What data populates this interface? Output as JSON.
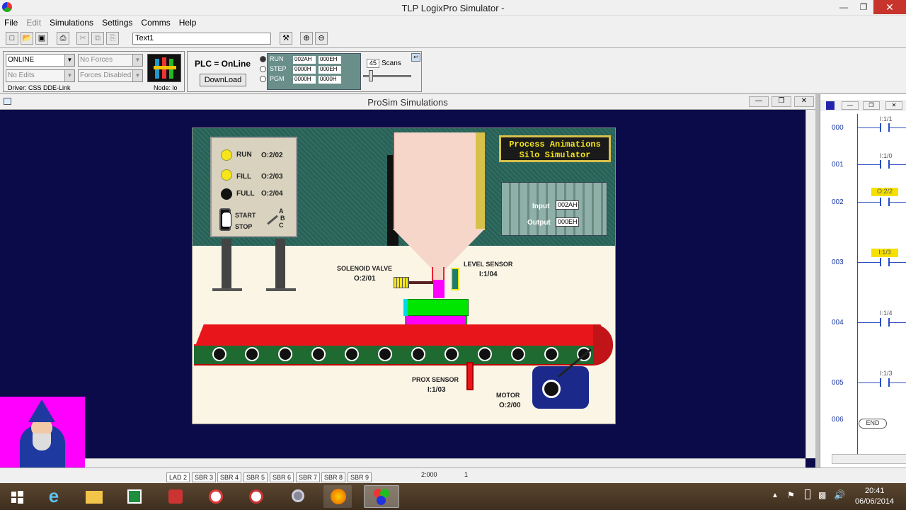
{
  "app": {
    "title": "TLP LogixPro Simulator  -"
  },
  "menu": [
    "File",
    "Edit",
    "Simulations",
    "Settings",
    "Comms",
    "Help"
  ],
  "toolbar": {
    "text_field": "Text1"
  },
  "status": {
    "mode": "ONLINE",
    "forces": "No Forces",
    "edits": "No Edits",
    "forces_disabled": "Forces Disabled",
    "driver": "Driver: CSS DDE-Link",
    "node": "Node: lo",
    "plc_state": "PLC = OnLine",
    "download_label": "DownLoad",
    "run_label": "RUN",
    "step_label": "STEP",
    "pgm_label": "PGM",
    "reg1": "002AH",
    "reg2": "000EH",
    "reg3": "0000H",
    "reg4": "000EH",
    "reg5": "0000H",
    "reg6": "0000H",
    "scans_value": "45",
    "scans_label": "Scans"
  },
  "prosim": {
    "title": "ProSim Simulations"
  },
  "scene": {
    "banner_line1": "Process Animations",
    "banner_line2": "Silo Simulator",
    "run": "RUN",
    "run_addr": "O:2/02",
    "fill": "FILL",
    "fill_addr": "O:2/03",
    "full": "FULL",
    "full_addr": "O:2/04",
    "start": "START",
    "stop": "STOP",
    "abc_a": "A",
    "abc_b": "B",
    "abc_c": "C",
    "input_label": "Input",
    "input_value": "002AH",
    "output_label": "Output",
    "output_value": "000EH",
    "solenoid": "SOLENOID VALVE",
    "solenoid_addr": "O:2/01",
    "level": "LEVEL SENSOR",
    "level_addr": "I:1/04",
    "prox": "PROX SENSOR",
    "prox_addr": "I:1/03",
    "motor": "MOTOR",
    "motor_addr": "O:2/00"
  },
  "ladder": {
    "rungs": [
      {
        "num": "000",
        "addr": "I:1/1"
      },
      {
        "num": "001",
        "addr": "I:1/0"
      },
      {
        "num": "002",
        "addr": "O:2/2"
      },
      {
        "num": "003",
        "addr": "I:1/3"
      },
      {
        "num": "004",
        "addr": "I:1/4"
      },
      {
        "num": "005",
        "addr": "I:1/3"
      },
      {
        "num": "006",
        "addr": "END"
      }
    ]
  },
  "tabs": [
    "LAD 2",
    "SBR 3",
    "SBR 4",
    "SBR 5",
    "SBR 6",
    "SBR 7",
    "SBR 8",
    "SBR 9"
  ],
  "status_bar": {
    "cell1": "2:000",
    "cell2": "1"
  },
  "clock": {
    "time": "20:41",
    "date": "06/06/2014"
  },
  "colors": {
    "prosim_bg": "#0b0b4a",
    "belt": "#e8161a",
    "highlight": "#f6e000",
    "pink": "#ff00ff"
  }
}
